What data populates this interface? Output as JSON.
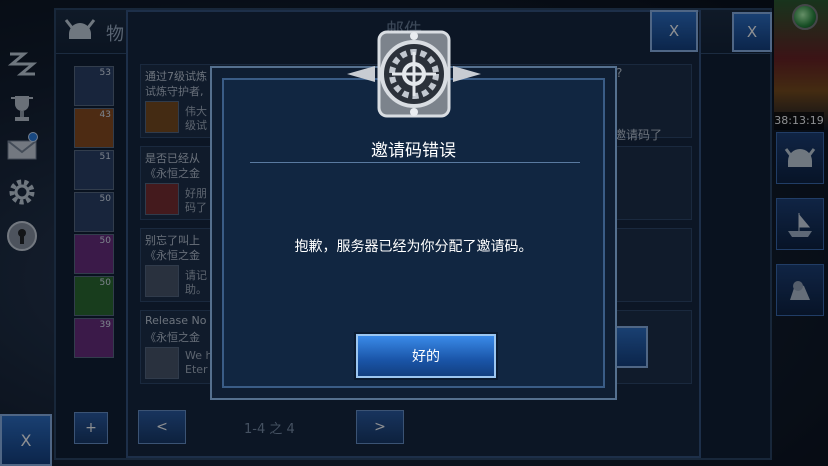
{
  "left_rail": {
    "items": [
      {
        "icon": "zz-sleep-icon"
      },
      {
        "icon": "trophy-icon"
      },
      {
        "icon": "mail-icon"
      },
      {
        "icon": "gear-icon"
      },
      {
        "icon": "keyhole-icon"
      }
    ],
    "close_label": "X"
  },
  "right_rail": {
    "timer": "38:13:19"
  },
  "inventory_panel": {
    "title": "物",
    "close_label": "X",
    "add_label": "+",
    "slots": [
      {
        "count": "53",
        "color": "#2a4a8a"
      },
      {
        "count": "43",
        "color": "#8a4a18"
      },
      {
        "count": "51",
        "color": "#2a4a8a"
      },
      {
        "count": "50",
        "color": "#2a4a8a"
      },
      {
        "count": "50",
        "color": "#6a2a7a"
      },
      {
        "count": "50",
        "color": "#2a6a2a"
      },
      {
        "count": "39",
        "color": "#6a2a7a"
      }
    ]
  },
  "mail_panel": {
    "title": "邮件",
    "close_label": "X",
    "rows": [
      {
        "line1": "通过7级试炼",
        "line2": "试炼守护者,",
        "line3": "伟大",
        "line4": "级试"
      },
      {
        "line1": "是否已经从",
        "line2": "《永恒之金",
        "line3": "好朋",
        "line4": "码了"
      },
      {
        "line1": "别忘了叫上",
        "line2": "《永恒之金",
        "line3": "请记",
        "line4": "助。"
      },
      {
        "line1": "Release No",
        "line2": "《永恒之金",
        "line3": "We h",
        "line4": "Eter"
      }
    ],
    "right_question": "?",
    "right_text": "邀请码了",
    "pager": {
      "prev": "<",
      "next": ">",
      "range": "1-4 之 4"
    }
  },
  "dialog": {
    "title": "邀请码错误",
    "message": "抱歉，服务器已经为你分配了邀请码。",
    "ok_label": "好的"
  }
}
